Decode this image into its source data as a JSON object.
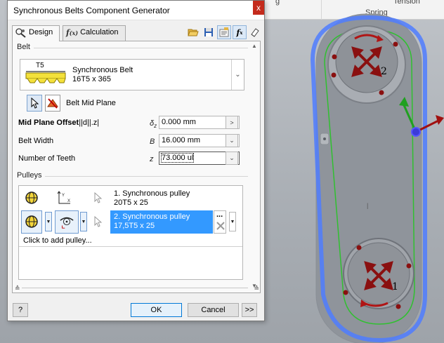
{
  "viewport": {
    "ribbon_left_label": "g",
    "ribbon_right_label": "Tension",
    "ribbon_spring_label": "Spring",
    "pulley_top_number": "2",
    "pulley_bottom_number": "1"
  },
  "dialog": {
    "title": "Synchronous Belts Component Generator",
    "close_glyph": "x",
    "tabs": [
      {
        "label": "Design",
        "icon": "design-tab-icon"
      },
      {
        "label": "Calculation",
        "icon": "calculation-tab-icon"
      }
    ],
    "toolbar_icons": [
      "open-folder-icon",
      "save-icon",
      "properties-icon",
      "calculate-fx-icon",
      "eraser-icon"
    ],
    "belt_group": {
      "label": "Belt",
      "thumbnail_code": "T5",
      "name": "Synchronous Belt",
      "size": "16T5 x 365"
    },
    "plane": {
      "label": "Belt Mid Plane"
    },
    "fields": [
      {
        "label_bold": "Mid Plane Offset",
        "label_extra": "||d||.z|",
        "symbol": "δz",
        "value": "0.000 mm"
      },
      {
        "label_bold": "",
        "label_extra": "Belt Width",
        "symbol": "B",
        "value": "16.000 mm"
      },
      {
        "label_bold": "",
        "label_extra": "Number of Teeth",
        "symbol": "z",
        "value": "73.000 ul"
      }
    ],
    "pulleys_group": {
      "label": "Pulleys",
      "rows": [
        {
          "line1": "1. Synchronous pulley",
          "line2": "20T5 x 25",
          "selected": false
        },
        {
          "line1": "2. Synchronous pulley",
          "line2": "17,5T5 x 25",
          "selected": true
        }
      ],
      "row_more": "...",
      "add_label": "Click to add pulley..."
    },
    "buttons": {
      "help": "?",
      "ok": "OK",
      "cancel": "Cancel",
      "more": ">>"
    }
  },
  "colors": {
    "selection_blue": "#3399ff",
    "belt_blue": "#4f7cff",
    "belt_outline_green": "#30c030",
    "marker_red": "#a01010",
    "axis_green": "#20a020",
    "close_red": "#c42b1c"
  }
}
